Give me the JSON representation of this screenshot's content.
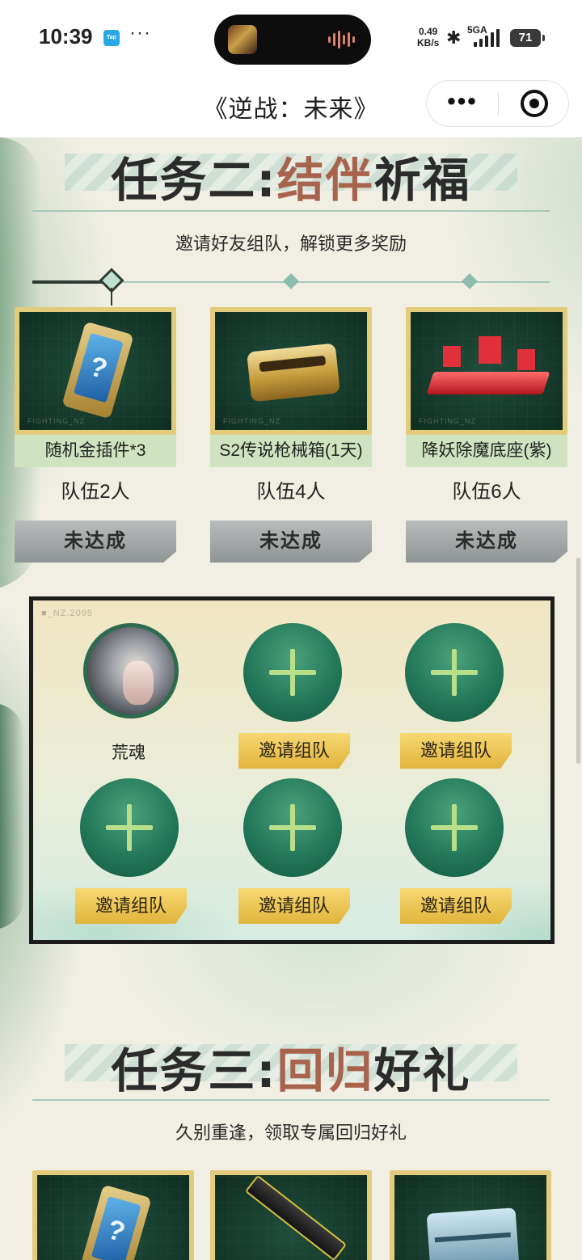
{
  "status_bar": {
    "time": "10:39",
    "tap_badge": "Tap",
    "dots": "···",
    "net_speed_value": "0.49",
    "net_speed_unit": "KB/s",
    "signal_label": "5GA",
    "battery": "71"
  },
  "nav": {
    "title": "《逆战：未来》",
    "more_label": "•••"
  },
  "task2": {
    "title_prefix": "任务二:",
    "title_accent": "结伴",
    "title_suffix": "祈福",
    "subtitle": "邀请好友组队，解锁更多奖励",
    "rewards": [
      {
        "name": "随机金插件*3",
        "team": "队伍2人",
        "status": "未达成",
        "icon": "gold-plugin-icon"
      },
      {
        "name": "S2传说枪械箱(1天)",
        "team": "队伍4人",
        "status": "未达成",
        "icon": "weapon-crate-icon"
      },
      {
        "name": "降妖除魔底座(紫)",
        "team": "队伍6人",
        "status": "未达成",
        "icon": "pedestal-icon"
      }
    ],
    "watermark": "FIGHTING_NZ"
  },
  "team": {
    "panel_tag": "■_NZ.2095",
    "member_name": "荒魂",
    "invite_label": "邀请组队"
  },
  "task3": {
    "title_prefix": "任务三:",
    "title_accent": "回归",
    "title_suffix": "好礼",
    "subtitle": "久别重逢，领取专属回归好礼"
  },
  "colors": {
    "accent_title": "#a8634d",
    "invite_gold": "#e1b43c",
    "slot_green": "#23785a"
  }
}
